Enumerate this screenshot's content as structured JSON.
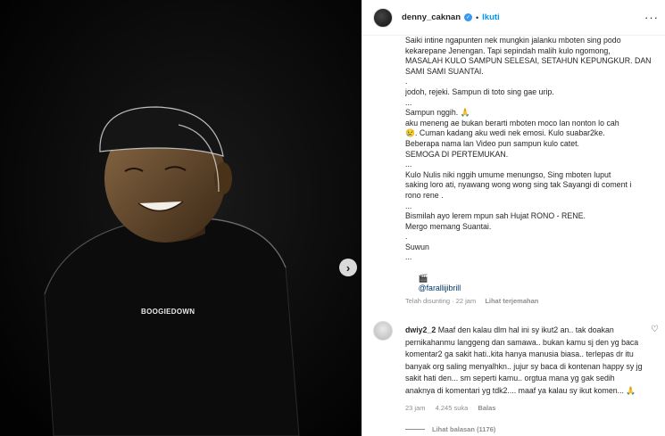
{
  "post": {
    "username": "denny_caknan",
    "follow_label": "Ikuti",
    "verified_glyph": "✓",
    "dot": "•",
    "more_glyph": "···",
    "shirt_text": "BOOGIEDOWN"
  },
  "caption": {
    "lines": [
      "Saiki intine ngapunten nek mungkin jalanku mboten sing podo",
      "kekarepane Jenengan. Tapi sepindah malih kulo ngomong,",
      "MASALAH KULO SAMPUN SELESAI, SETAHUN KEPUNGKUR. DAN",
      "SAMI SAMI SUANTAI.",
      ".",
      "jodoh, rejeki. Sampun di toto sing gae urip.",
      "...",
      "Sampun nggih. 🙏",
      "aku meneng ae bukan berarti mboten moco lan nonton lo cah",
      "😢. Cuman kadang aku wedi nek emosi. Kulo suabar2ke.",
      "Beberapa nama lan Video pun sampun kulo catet.",
      "SEMOGA DI PERTEMUKAN.",
      "...",
      "Kulo Nulis niki nggih umume menungso, Sing mboten luput",
      "saking loro ati, nyawang wong wong sing tak Sayangi di coment i",
      "rono rene .",
      "...",
      "Bismilah ayo lerem mpun sah Hujat RONO - RENE.",
      "Mergo memang Suantai.",
      ".",
      "Suwun",
      "..."
    ],
    "credit_icon": "🎬",
    "credit_mention": "@farallijibrill",
    "edited": "Telah disunting · 22 jam",
    "translate": "Lihat terjemahan"
  },
  "comment": {
    "user": "dwiy2_2",
    "text": "Maaf den kalau dlm hal ini sy ikut2 an.. tak doakan pernikahanmu langgeng dan samawa.. bukan kamu sj den yg baca komentar2 ga sakit hati..kita hanya manusia biasa.. terlepas dr itu banyak org saling menyalhkn.. jujur sy baca di kontenan happy sy jg sakit hati den... sm seperti kamu.. orgtua mana yg gak sedih anaknya di komentari yg tdk2.... maaf ya kalau sy ikut komen... 🙏",
    "time": "23 jam",
    "likes": "4.245 suka",
    "reply": "Balas",
    "heart_glyph": "♡"
  },
  "replies": {
    "label": "Lihat balasan (1176)"
  },
  "nav": {
    "next_glyph": "›"
  }
}
